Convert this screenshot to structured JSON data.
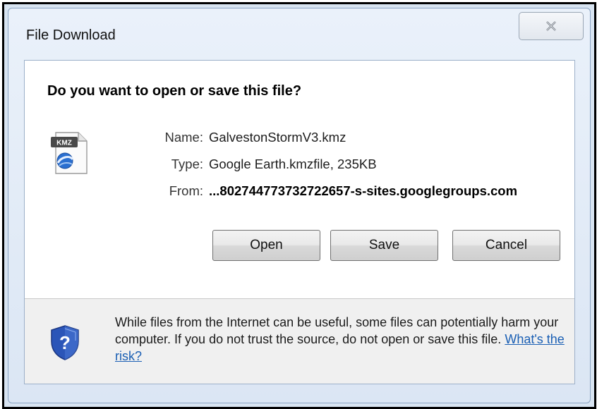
{
  "dialog": {
    "title": "File Download",
    "question": "Do you want to open or save this file?",
    "file": {
      "name_label": "Name:",
      "name_value": "GalvestonStormV3.kmz",
      "type_label": "Type:",
      "type_value": "Google Earth.kmzfile, 235KB",
      "from_label": "From:",
      "from_value": "...802744773732722657-s-sites.googlegroups.com",
      "icon_text": "KMZ"
    },
    "buttons": {
      "open": "Open",
      "save": "Save",
      "cancel": "Cancel"
    },
    "warning": {
      "text": "While files from the Internet can be useful, some files can potentially harm your computer. If you do not trust the source, do not open or save this file.",
      "link": "What's the risk?"
    }
  },
  "colors": {
    "link": "#1a5fb4",
    "window_bg": "#dbe6f4",
    "shield_blue": "#2b55b8"
  }
}
